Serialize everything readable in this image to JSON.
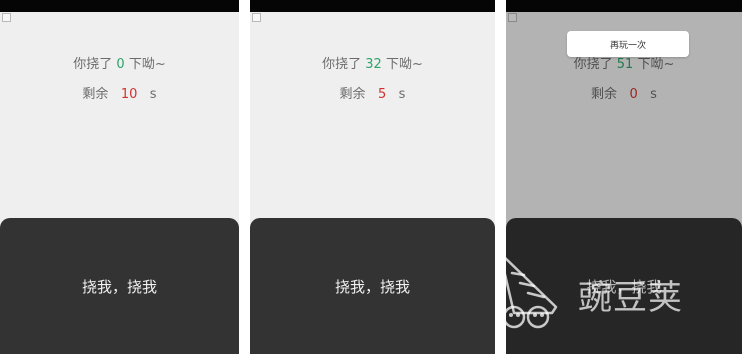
{
  "screens": [
    {
      "counter_prefix": "你挠了",
      "counter_value": "0",
      "counter_suffix": "下呦~",
      "remain_prefix": "剩余",
      "remain_value": "10",
      "remain_unit": "s",
      "tap_label": "挠我，挠我"
    },
    {
      "counter_prefix": "你挠了",
      "counter_value": "32",
      "counter_suffix": "下呦~",
      "remain_prefix": "剩余",
      "remain_value": "5",
      "remain_unit": "s",
      "tap_label": "挠我，挠我"
    },
    {
      "counter_prefix": "你挠了",
      "counter_value": "51",
      "counter_suffix": "下呦~",
      "remain_prefix": "剩余",
      "remain_value": "0",
      "remain_unit": "s",
      "tap_label": "挠我，挠我",
      "replay_label": "再玩一次"
    }
  ],
  "watermark": {
    "text": "豌豆荚",
    "logo_icon": "wandoujia-logo-icon"
  },
  "colors": {
    "counter_green": "#2fa36a",
    "timer_red": "#d2322d",
    "tap_area": "#333333",
    "screen_bg": "#efefef"
  }
}
